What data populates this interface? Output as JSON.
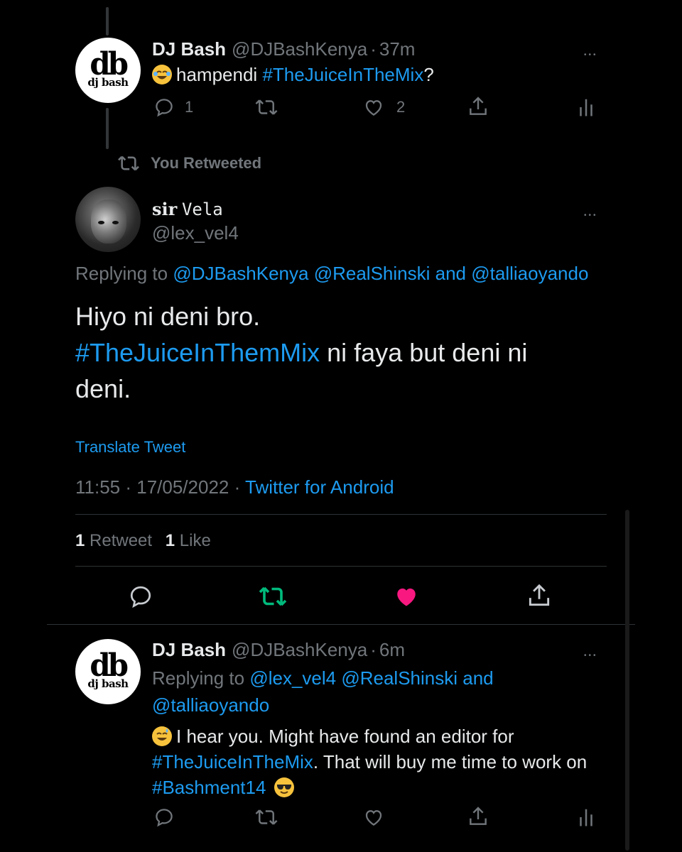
{
  "tweet1": {
    "name": "DJ Bash",
    "handle": "@DJBashKenya",
    "time": "37m",
    "avatar_mark": "db",
    "avatar_word": "dj bash",
    "text_plain": "hampendi",
    "hashtag": "#TheJuiceInTheMix",
    "text_end": "?",
    "reply_count": "1",
    "like_count": "2"
  },
  "retweet_banner": {
    "label": "You Retweeted"
  },
  "main": {
    "name_prefix": "sir",
    "name_suffix": "Vela",
    "handle": "@lex_vel4",
    "replying_label": "Replying to",
    "replying_to": [
      "@DJBashKenya",
      "@RealShinski"
    ],
    "replying_and": "and",
    "replying_last": "@talliaoyando",
    "text_line1": "Hiyo ni deni bro.",
    "text_hashtag": "#TheJuiceInThemMix",
    "text_line2_rest": "ni faya but deni ni",
    "text_line3": "deni.",
    "translate": "Translate Tweet",
    "timestamp": "11:55 · 17/05/2022 ·",
    "source": "Twitter for Android",
    "retweet_count": "1",
    "retweet_label": "Retweet",
    "like_count": "1",
    "like_label": "Like"
  },
  "tweet3": {
    "name": "DJ Bash",
    "handle": "@DJBashKenya",
    "time": "6m",
    "avatar_mark": "db",
    "avatar_word": "dj bash",
    "replying_label": "Replying to",
    "replying_to": [
      "@lex_vel4",
      "@RealShinski"
    ],
    "replying_and": "and",
    "replying_last": "@talliaoyando",
    "text_1": "I hear you. Might have found an editor for",
    "text_hashtag1": "#TheJuiceInTheMix",
    "text_2": ". That will buy me time to work on",
    "text_hashtag2": "#Bashment14"
  },
  "colors": {
    "accent_blue": "#1d9bf0",
    "retweet_green": "#00ba7c",
    "like_pink": "#f91880",
    "muted": "#71767b"
  },
  "icons": [
    "reply-icon",
    "retweet-icon",
    "like-icon",
    "share-icon",
    "analytics-icon",
    "more-icon"
  ]
}
